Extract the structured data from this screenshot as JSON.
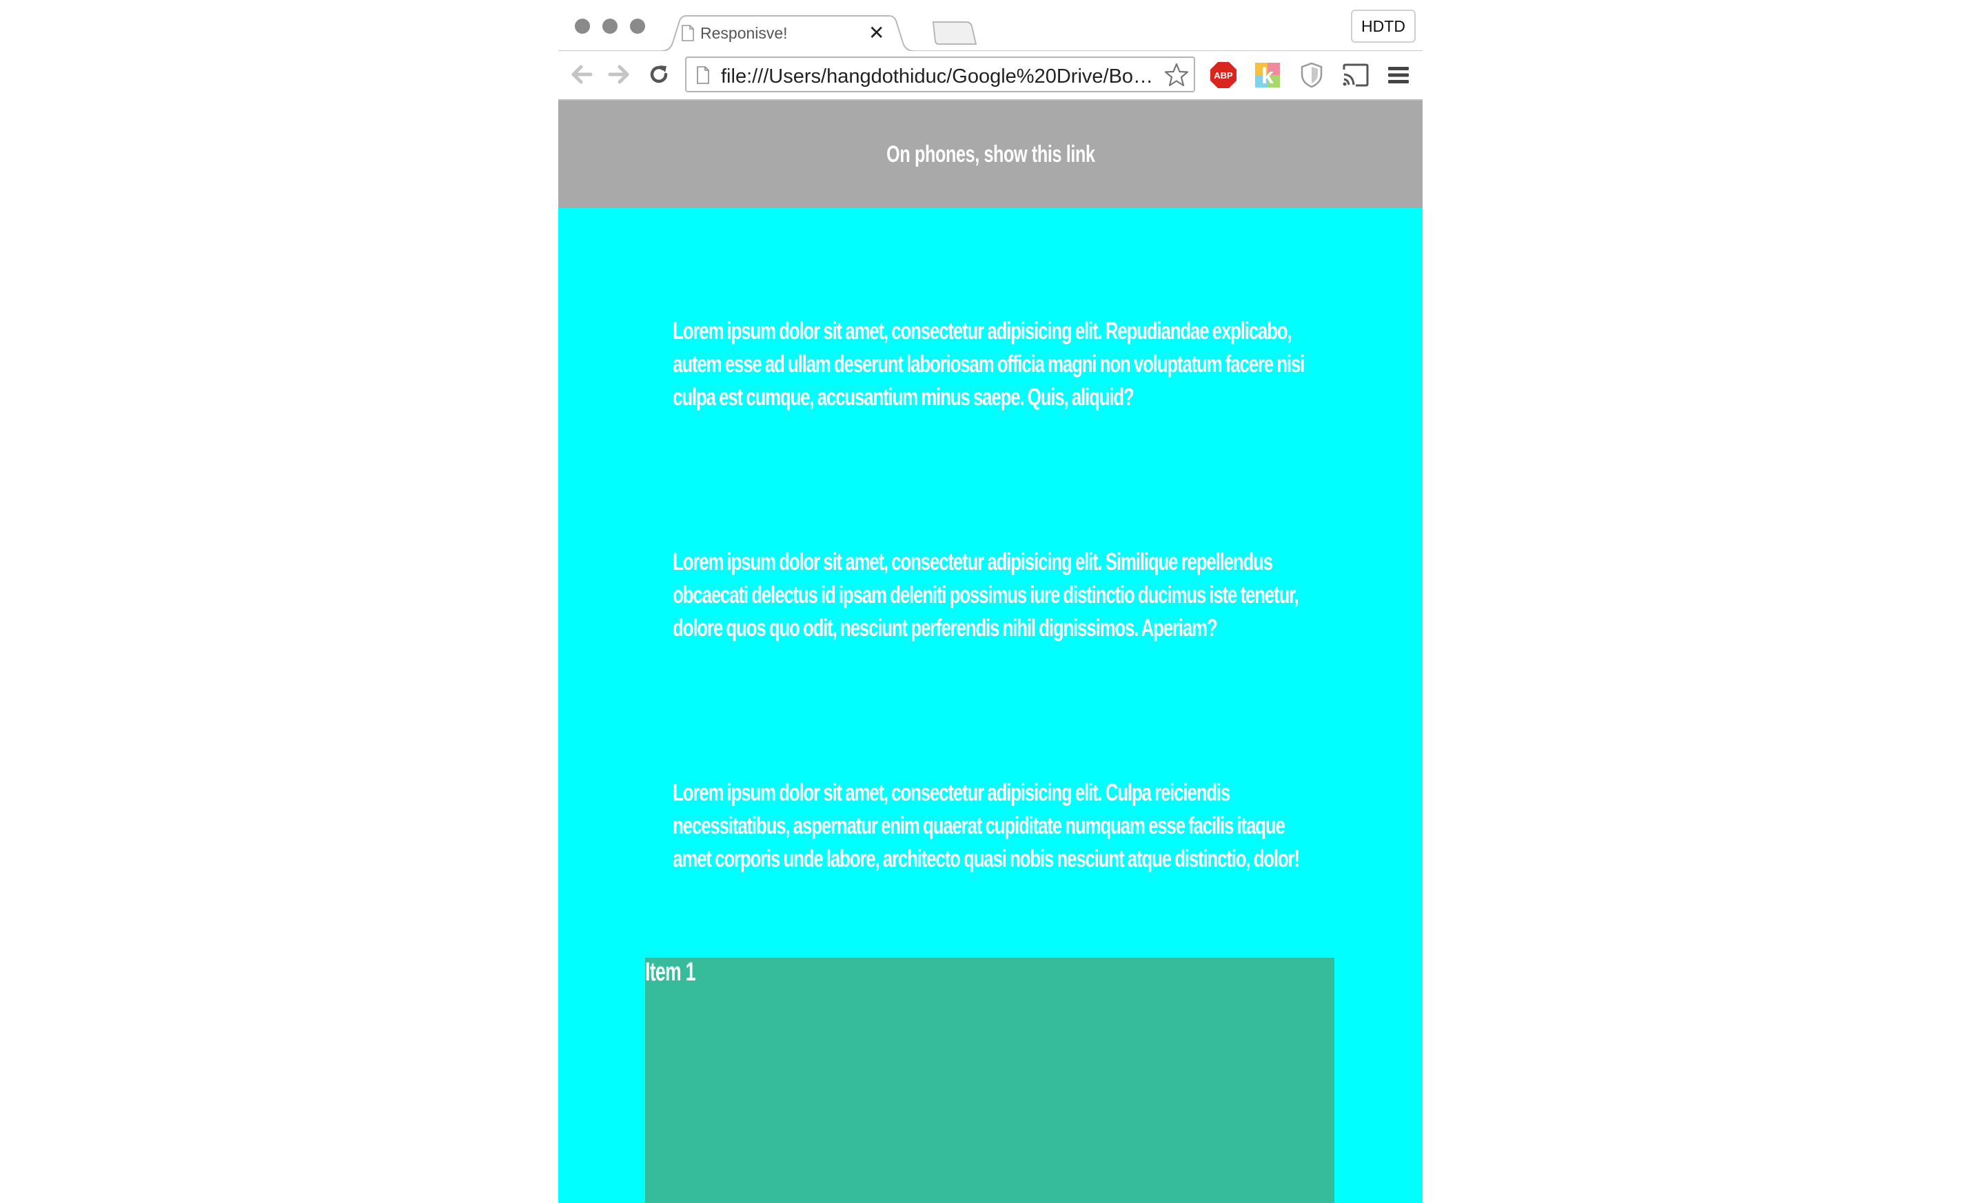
{
  "browser": {
    "tab": {
      "title": "Responisve!",
      "close_glyph": "✕"
    },
    "profile_button": "HDTD",
    "address_bar": {
      "url": "file:///Users/hangdothiduc/Google%20Drive/Bo…"
    },
    "extensions": [
      "adblock-plus-icon",
      "kippt-icon",
      "shield-icon",
      "cast-icon",
      "menu-icon"
    ],
    "extension_labels": {
      "adblock": "ABP",
      "kippt": "k"
    }
  },
  "page": {
    "header_link": "On phones, show this link",
    "paragraphs": [
      "Lorem ipsum dolor sit amet, consectetur adipisicing elit. Repudiandae explicabo, autem esse ad ullam deserunt laboriosam officia magni non voluptatum facere nisi culpa est cumque, accusantium minus saepe. Quis, aliquid?",
      "Lorem ipsum dolor sit amet, consectetur adipisicing elit. Similique repellendus obcaecati delectus id ipsam deleniti possimus iure distinctio ducimus iste tenetur, dolore quos quo odit, nesciunt perferendis nihil dignissimos. Aperiam?",
      "Lorem ipsum dolor sit amet, consectetur adipisicing elit. Culpa reiciendis necessitatibus, aspernatur enim quaerat cupiditate numquam esse facilis itaque amet corporis unde labore, architecto quasi nobis nesciunt atque distinctio, dolor!"
    ],
    "item_label": "Item 1"
  },
  "colors": {
    "header_bg": "#a9a9a9",
    "page_bg": "#00ffff",
    "item_bg": "#36bc9b",
    "text": "#ffffff"
  }
}
